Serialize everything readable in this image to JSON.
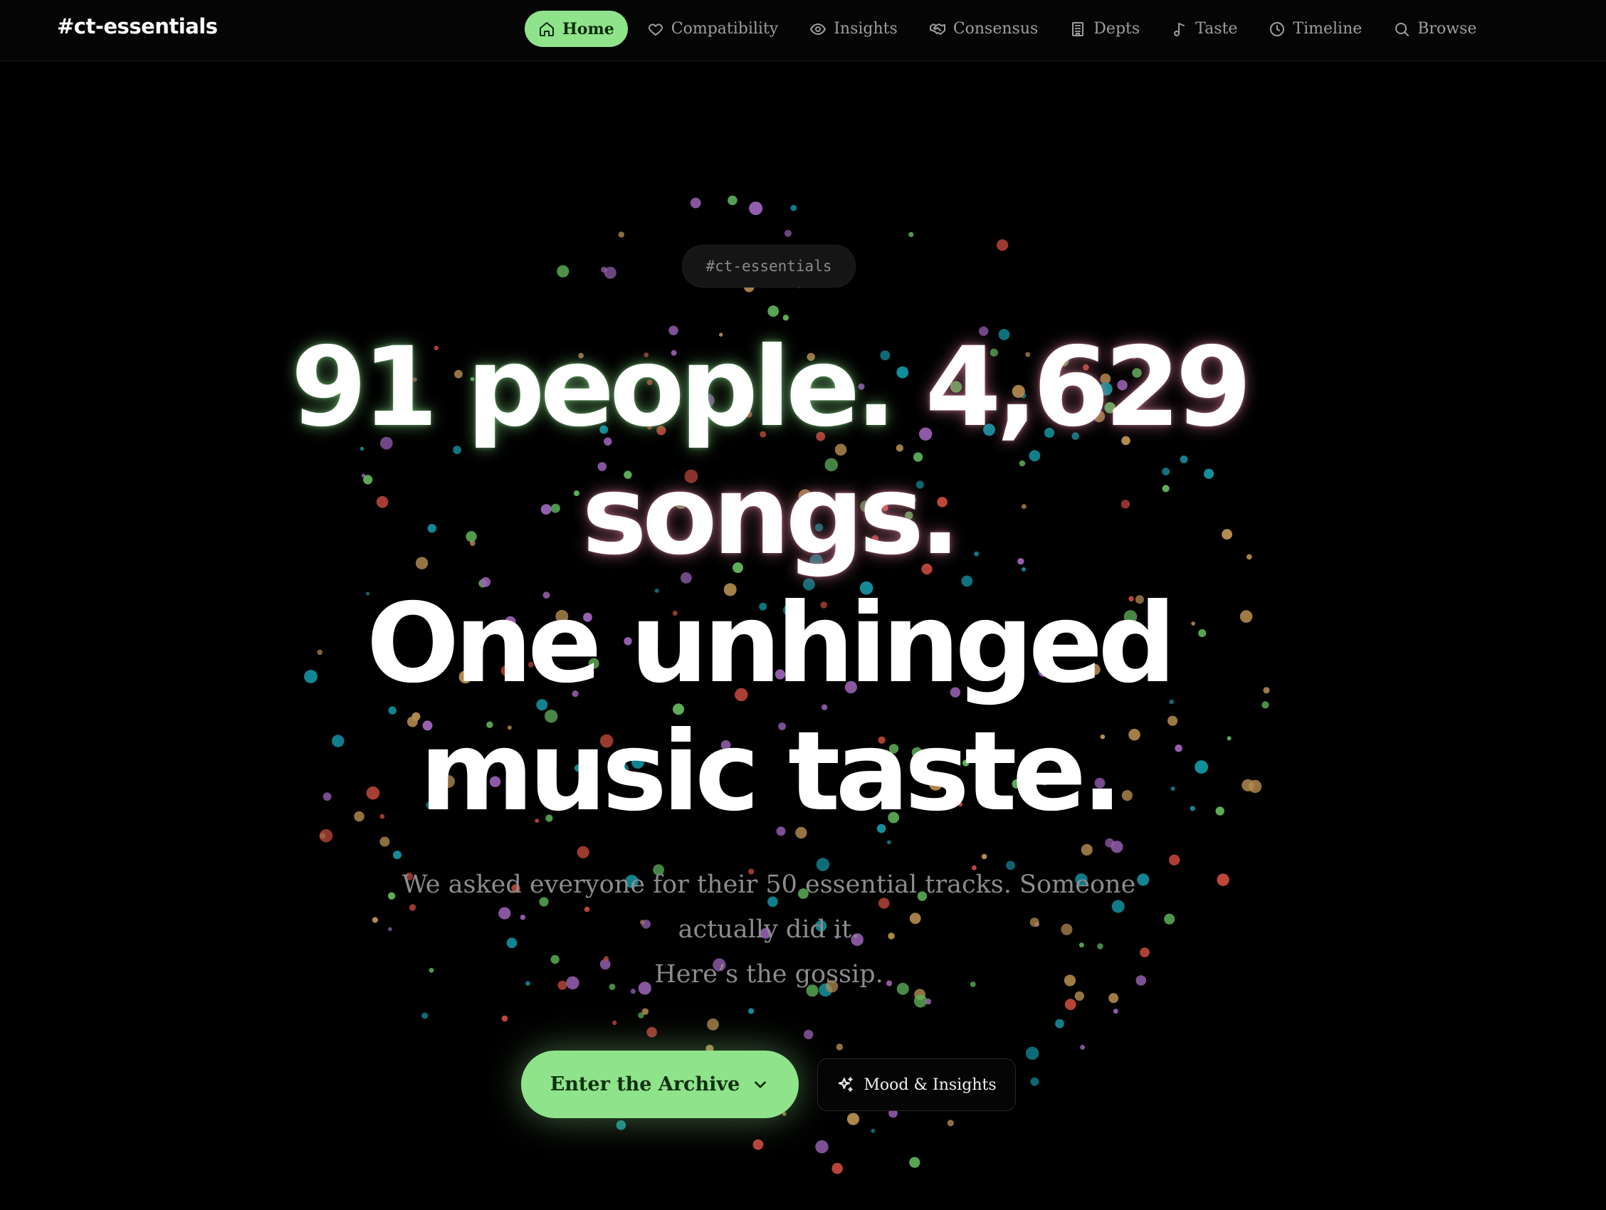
{
  "brand": "#ct-essentials",
  "nav": {
    "items": [
      {
        "label": "Home",
        "icon": "home-icon",
        "active": true
      },
      {
        "label": "Compatibility",
        "icon": "heart-icon",
        "active": false
      },
      {
        "label": "Insights",
        "icon": "eye-icon",
        "active": false
      },
      {
        "label": "Consensus",
        "icon": "handshake-icon",
        "active": false
      },
      {
        "label": "Depts",
        "icon": "building-icon",
        "active": false
      },
      {
        "label": "Taste",
        "icon": "music-note-icon",
        "active": false
      },
      {
        "label": "Timeline",
        "icon": "clock-icon",
        "active": false
      },
      {
        "label": "Browse",
        "icon": "search-icon",
        "active": false
      }
    ]
  },
  "hero": {
    "tag": "#ct-essentials",
    "headline": {
      "people": "91 people.",
      "songs_count": "4,629",
      "songs_word": "songs.",
      "line3": "One unhinged",
      "line4": "music taste."
    },
    "subtext": {
      "line1": "We asked everyone for their 50 essential tracks. Someone",
      "line2": "actually did it.",
      "line3": "Here’s the gossip."
    },
    "primary_button": "Enter the Archive",
    "secondary_button": "Mood & Insights"
  },
  "colors": {
    "accent": "#8fe38b",
    "background": "#000000",
    "dot_palette": [
      "#c0473b",
      "#9a62b5",
      "#5fb35a",
      "#138f9c",
      "#b58c4f"
    ]
  }
}
